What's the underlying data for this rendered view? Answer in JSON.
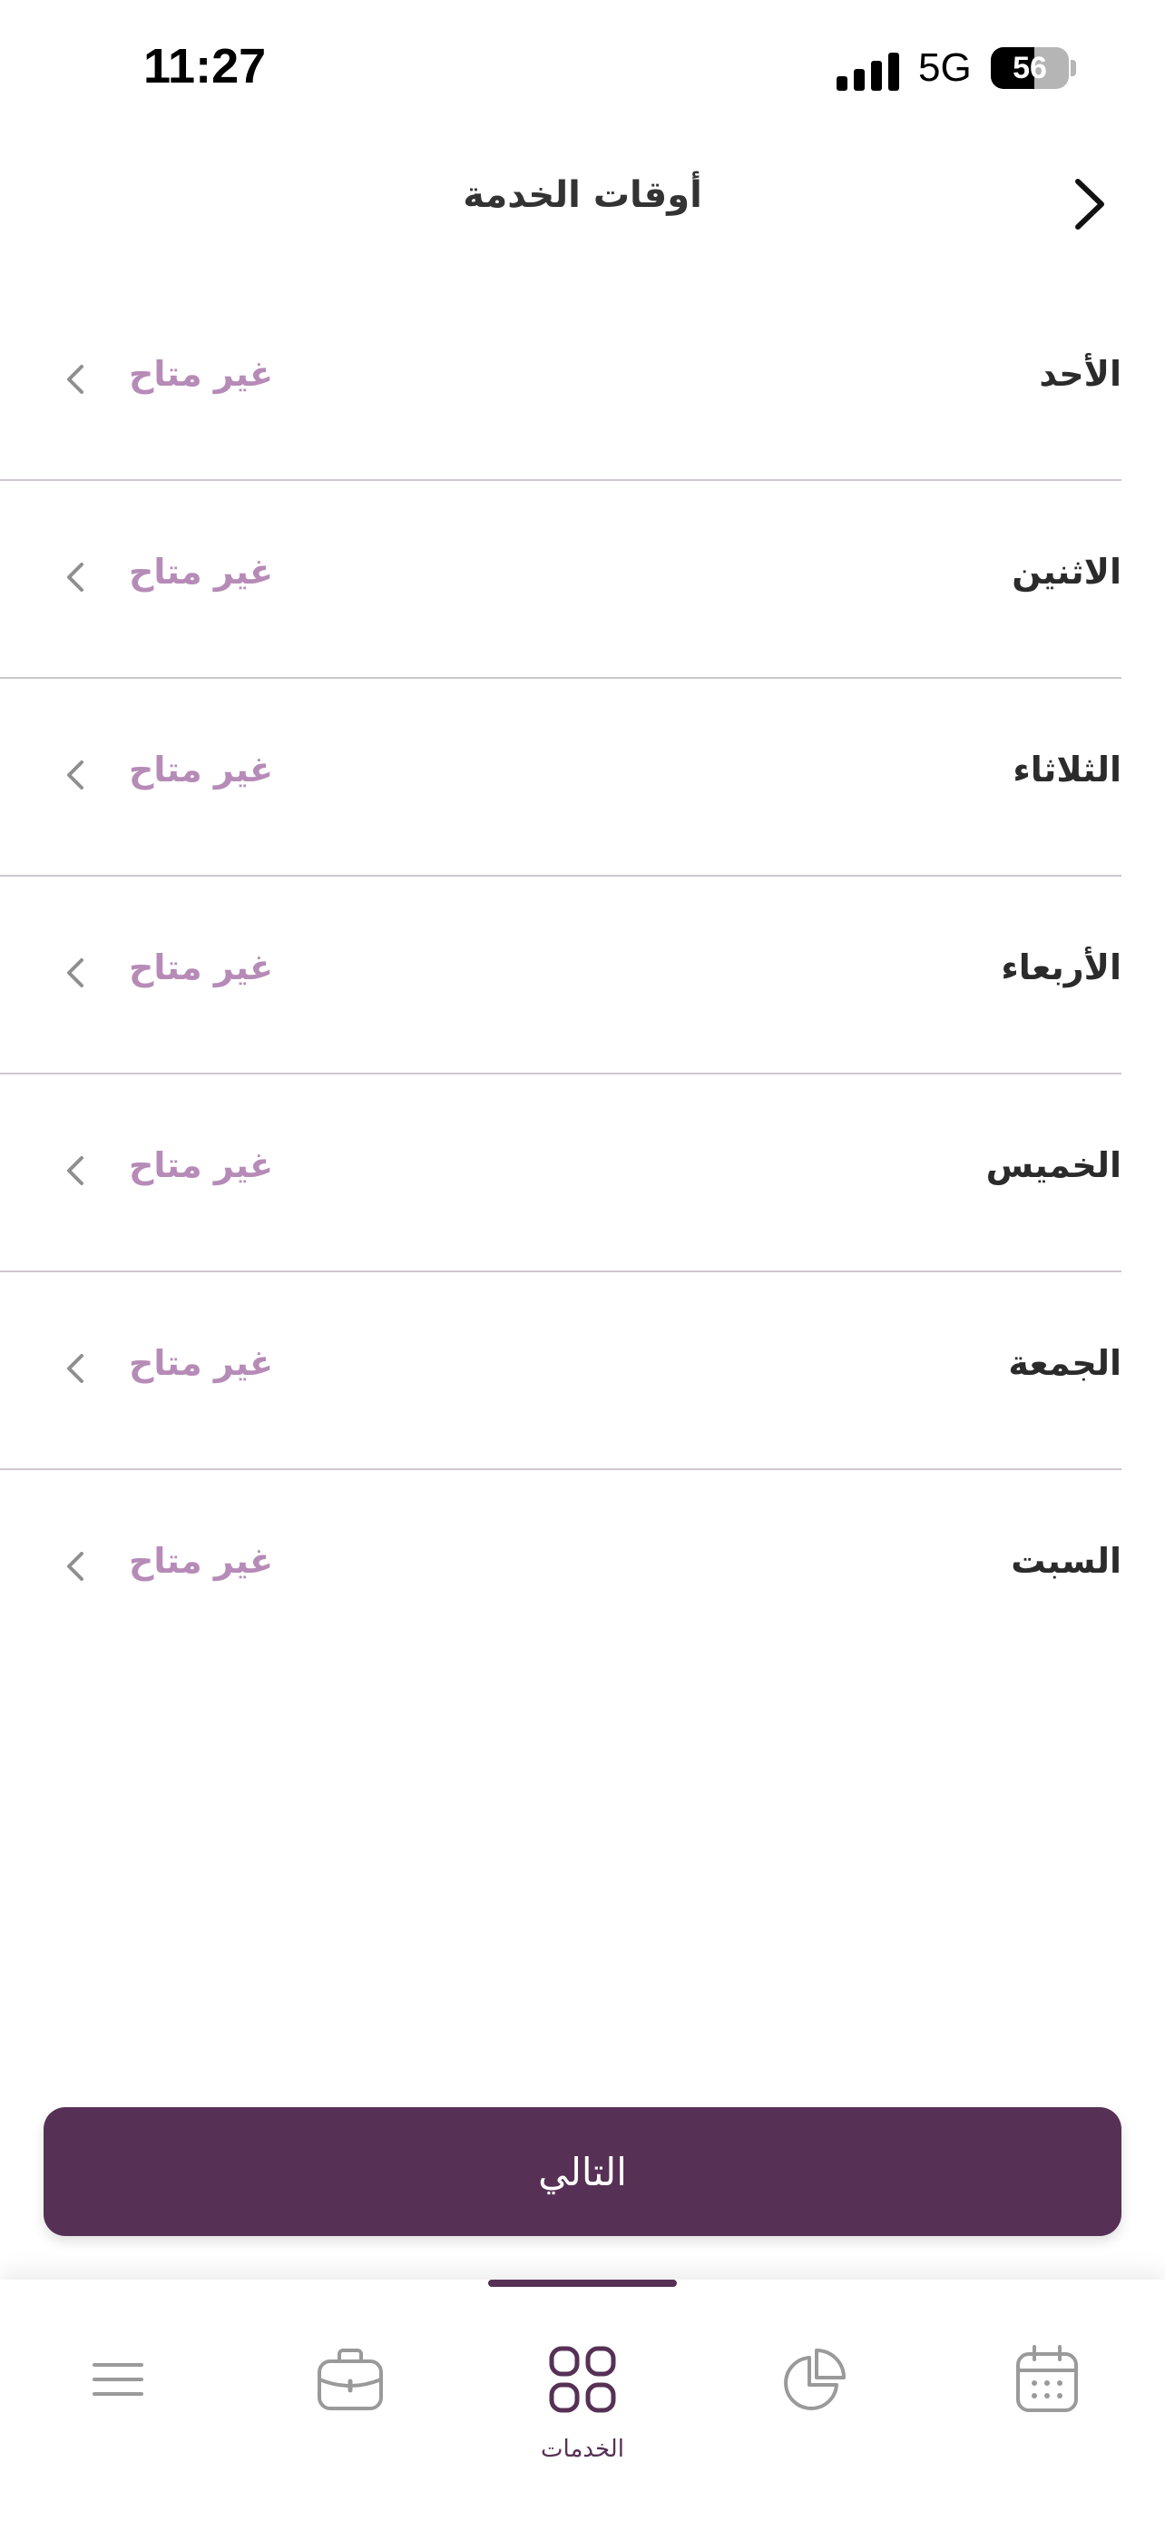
{
  "status_bar": {
    "time": "11:27",
    "network": "5G",
    "battery_text": "56",
    "battery_level": 0.56
  },
  "header": {
    "title": "أوقات الخدمة"
  },
  "days": [
    {
      "day": "الأحد",
      "status": "غير متاح"
    },
    {
      "day": "الاثنين",
      "status": "غير متاح"
    },
    {
      "day": "الثلاثاء",
      "status": "غير متاح"
    },
    {
      "day": "الأربعاء",
      "status": "غير متاح"
    },
    {
      "day": "الخميس",
      "status": "غير متاح"
    },
    {
      "day": "الجمعة",
      "status": "غير متاح"
    },
    {
      "day": "السبت",
      "status": "غير متاح"
    }
  ],
  "next_button": {
    "label": "التالي"
  },
  "tabbar": {
    "tabs": [
      {
        "icon": "menu-icon",
        "label": ""
      },
      {
        "icon": "briefcase-icon",
        "label": ""
      },
      {
        "icon": "grid-icon",
        "label": "الخدمات",
        "active": true
      },
      {
        "icon": "pie-chart-icon",
        "label": ""
      },
      {
        "icon": "calendar-icon",
        "label": ""
      }
    ]
  },
  "colors": {
    "accent": "#573155",
    "status_text": "#b68bb7",
    "inactive_icon": "#9a9a9a"
  }
}
